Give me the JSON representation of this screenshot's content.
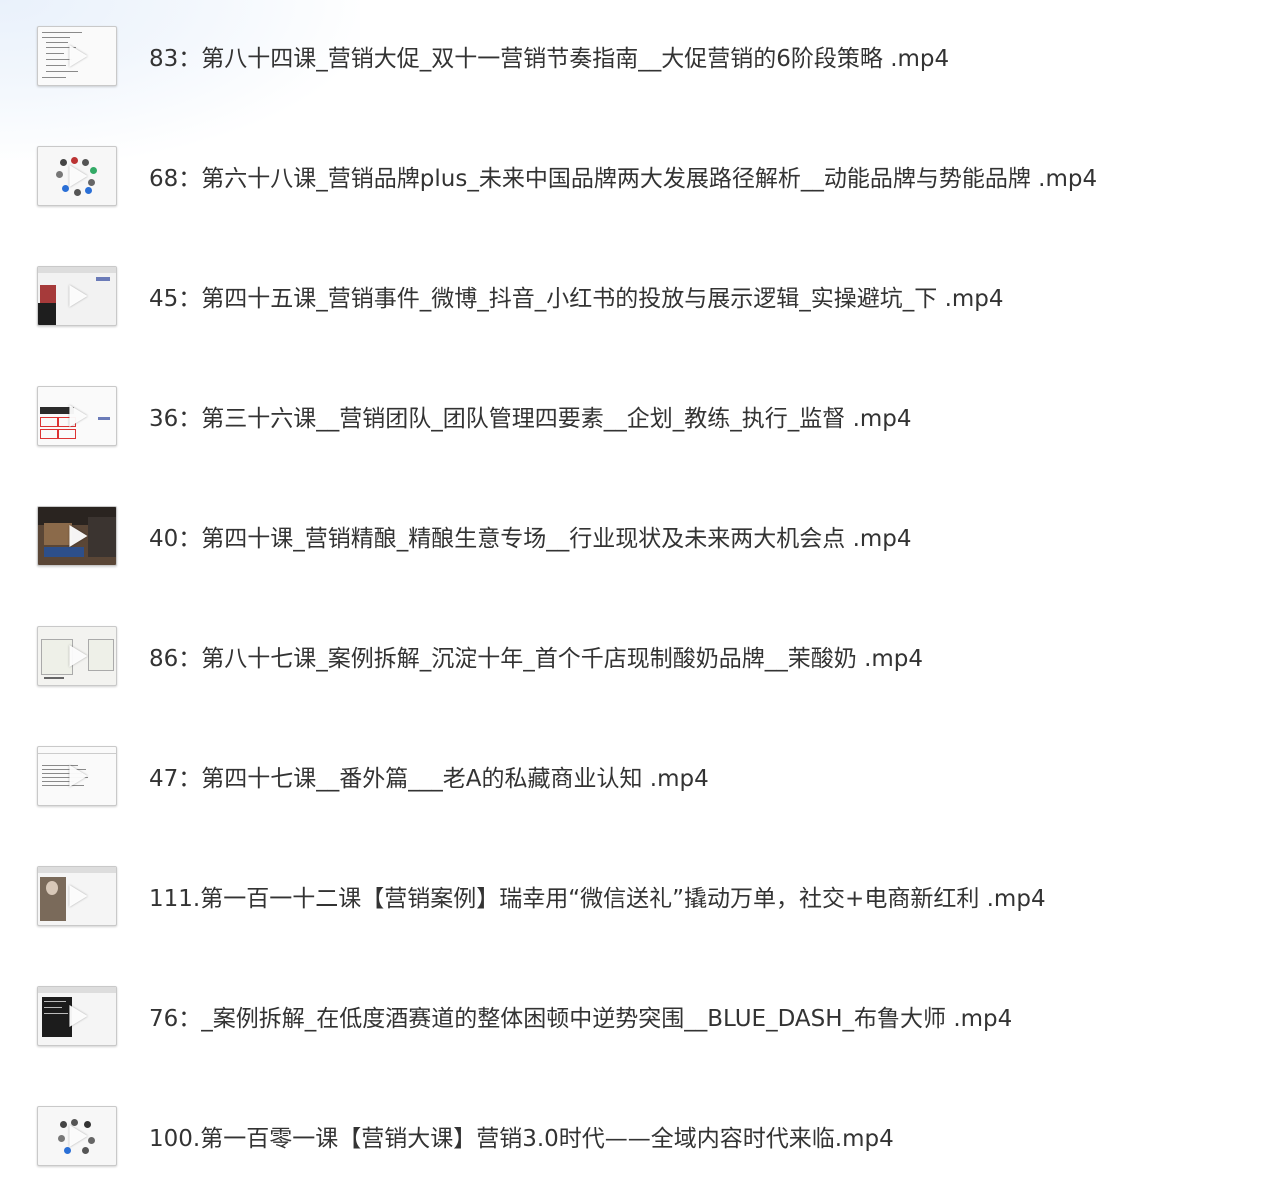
{
  "files": [
    {
      "name": "83：第八十四课_营销大促_双十一营销节奏指南__大促营销的6阶段策略 .mp4",
      "thumb_icon": "play-icon"
    },
    {
      "name": "68：第六十八课_营销品牌plus_未来中国品牌两大发展路径解析__动能品牌与势能品牌 .mp4",
      "thumb_icon": "play-icon"
    },
    {
      "name": "45：第四十五课_营销事件_微博_抖音_小红书的投放与展示逻辑_实操避坑_下 .mp4",
      "thumb_icon": "play-icon"
    },
    {
      "name": "36：第三十六课__营销团队_团队管理四要素__企划_教练_执行_监督 .mp4",
      "thumb_icon": "play-icon"
    },
    {
      "name": "40：第四十课_营销精酿_精酿生意专场__行业现状及未来两大机会点 .mp4",
      "thumb_icon": "play-icon"
    },
    {
      "name": "86：第八十七课_案例拆解_沉淀十年_首个千店现制酸奶品牌__茉酸奶 .mp4",
      "thumb_icon": "play-icon"
    },
    {
      "name": "47：第四十七课__番外篇___老A的私藏商业认知 .mp4",
      "thumb_icon": "play-icon"
    },
    {
      "name": "111.第一百一十二课【营销案例】瑞幸用“微信送礼”撬动万单，社交+电商新红利 .mp4",
      "thumb_icon": "play-icon"
    },
    {
      "name": "76：_案例拆解_在低度酒赛道的整体困顿中逆势突围__BLUE_DASH_布鲁大师 .mp4",
      "thumb_icon": "play-icon"
    },
    {
      "name": "100.第一百零一课【营销大课】营销3.0时代——全域内容时代来临.mp4",
      "thumb_icon": "play-icon"
    }
  ]
}
